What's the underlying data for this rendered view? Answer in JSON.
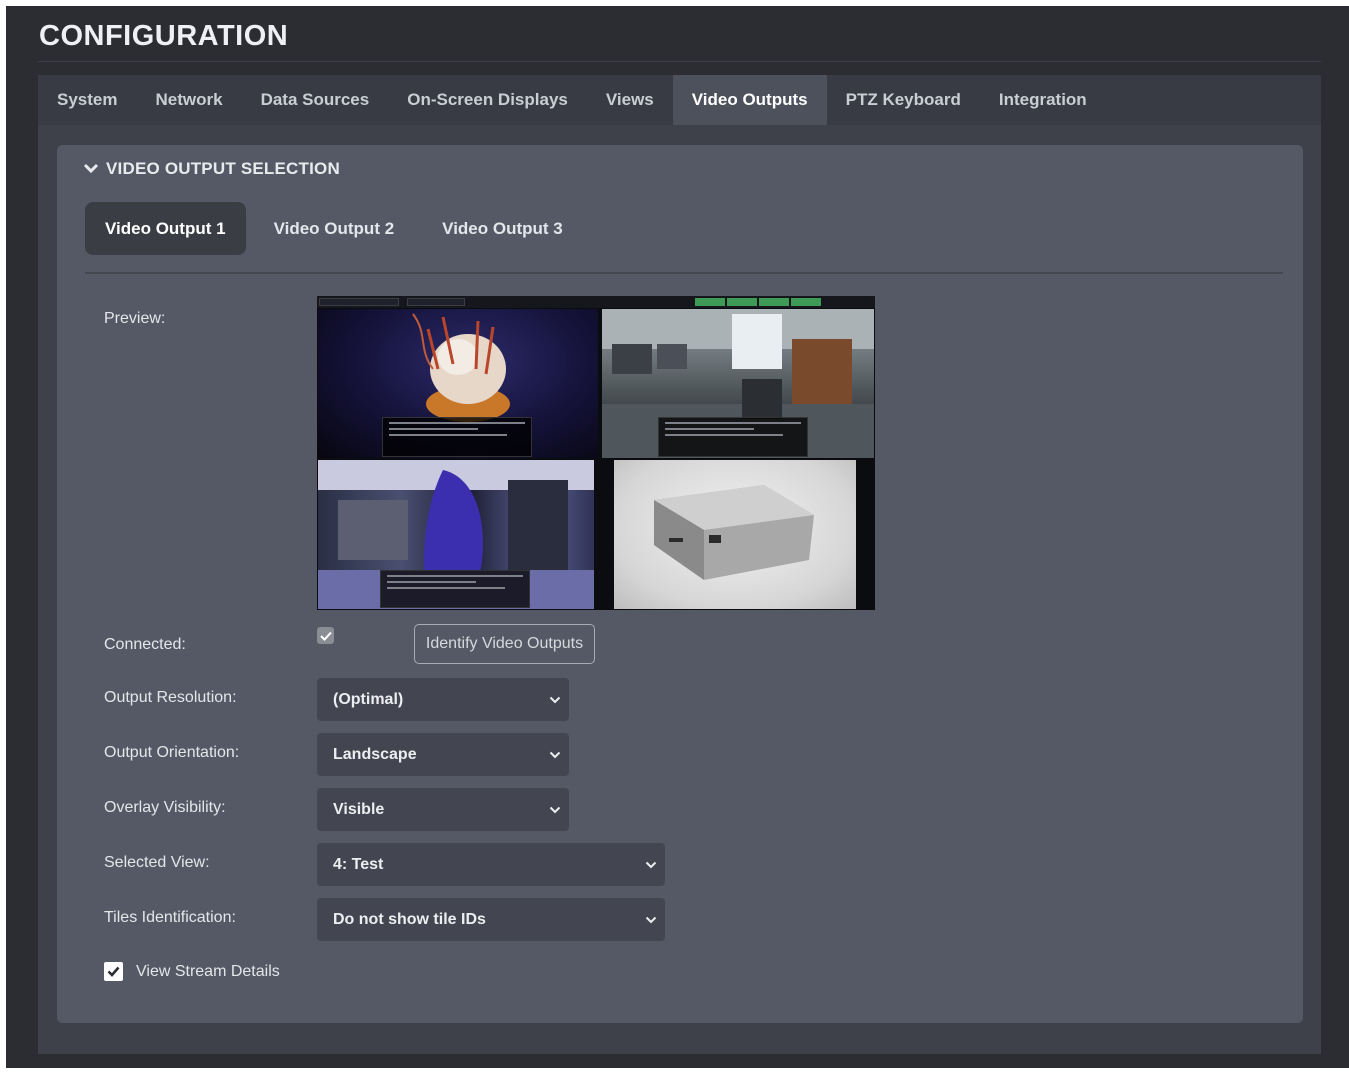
{
  "page": {
    "title": "CONFIGURATION"
  },
  "tabs": [
    {
      "label": "System"
    },
    {
      "label": "Network"
    },
    {
      "label": "Data Sources"
    },
    {
      "label": "On-Screen Displays"
    },
    {
      "label": "Views"
    },
    {
      "label": "Video Outputs",
      "active": true
    },
    {
      "label": "PTZ Keyboard"
    },
    {
      "label": "Integration"
    }
  ],
  "section": {
    "title": "VIDEO OUTPUT SELECTION",
    "icon": "chevron-down-icon",
    "subtabs": [
      {
        "label": "Video Output 1",
        "active": true
      },
      {
        "label": "Video Output 2"
      },
      {
        "label": "Video Output 3"
      }
    ]
  },
  "form": {
    "preview_label": "Preview:",
    "connected_label": "Connected:",
    "connected_checked": true,
    "identify_button": "Identify Video Outputs",
    "output_resolution": {
      "label": "Output Resolution:",
      "value": "(Optimal)"
    },
    "output_orientation": {
      "label": "Output Orientation:",
      "value": "Landscape"
    },
    "overlay_visibility": {
      "label": "Overlay Visibility:",
      "value": "Visible"
    },
    "selected_view": {
      "label": "Selected View:",
      "value": "4: Test"
    },
    "tiles_identification": {
      "label": "Tiles Identification:",
      "value": "Do not show tile IDs"
    },
    "view_stream_details": {
      "label": "View Stream Details",
      "checked": true
    }
  },
  "colors": {
    "background": "#2b2d33",
    "tab_bar": "#383b43",
    "tab_active": "#4d515b",
    "panel": "#555965",
    "select_bg": "#434650"
  }
}
